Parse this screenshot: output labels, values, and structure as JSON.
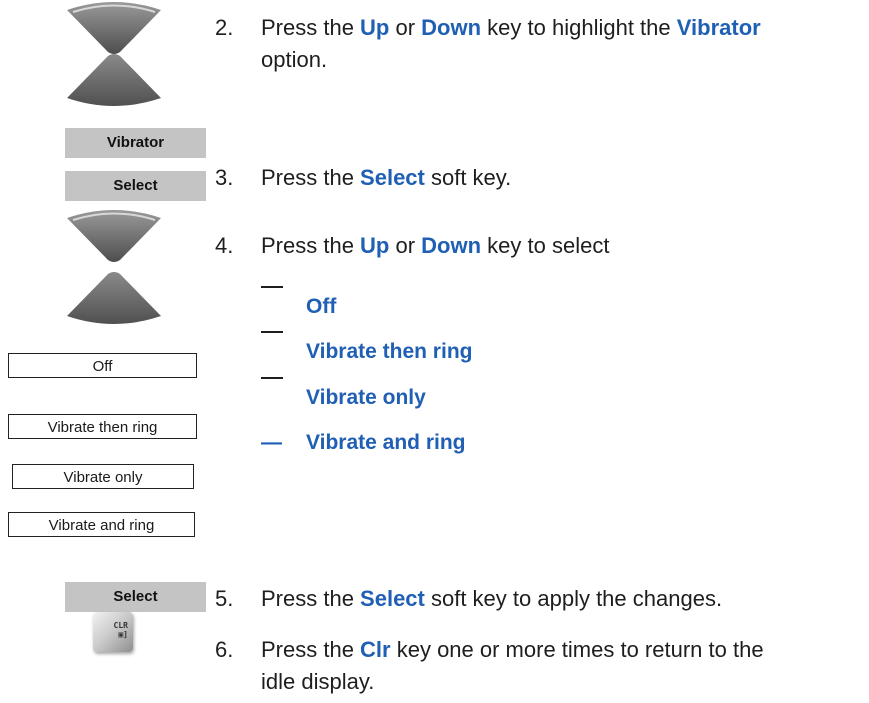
{
  "keys": {
    "nav_icon": "up-down-navigation-keys",
    "clr_icon": "clr-key",
    "clr_label_top": "CLR",
    "clr_label_bottom": "▣]"
  },
  "screens": {
    "vibrator_label": "Vibrator",
    "select_label_1": "Select",
    "select_label_2": "Select",
    "options": [
      "Off",
      "Vibrate then ring",
      "Vibrate only",
      "Vibrate and ring"
    ]
  },
  "steps": {
    "s2": {
      "num": "2.",
      "pre": "Press the ",
      "k1": "Up",
      "mid": " or ",
      "k2": "Down",
      "post": " key to highlight the ",
      "k3": "Vibrator",
      "end": " option."
    },
    "s3": {
      "num": "3.",
      "pre": "Press the ",
      "k1": "Select",
      "post": " soft key."
    },
    "s4": {
      "num": "4.",
      "pre": "Press the ",
      "k1": "Up",
      "mid": " or ",
      "k2": "Down",
      "post": " key to select"
    },
    "s4_bullets": [
      "Off",
      "Vibrate then ring",
      "Vibrate only",
      "Vibrate and ring"
    ],
    "s4_last_dash": "—",
    "s5": {
      "num": "5.",
      "pre": "Press the ",
      "k1": "Select",
      "post": " soft key to apply the changes."
    },
    "s6": {
      "num": "6.",
      "pre": "Press the ",
      "k1": "Clr",
      "post": " key one or more times to return to the",
      "line2": "idle display."
    }
  },
  "colors": {
    "keyword": "#1f5fb4",
    "softkey_bg": "#c4c4c4",
    "navkey_dark": "#6a6a6a"
  }
}
